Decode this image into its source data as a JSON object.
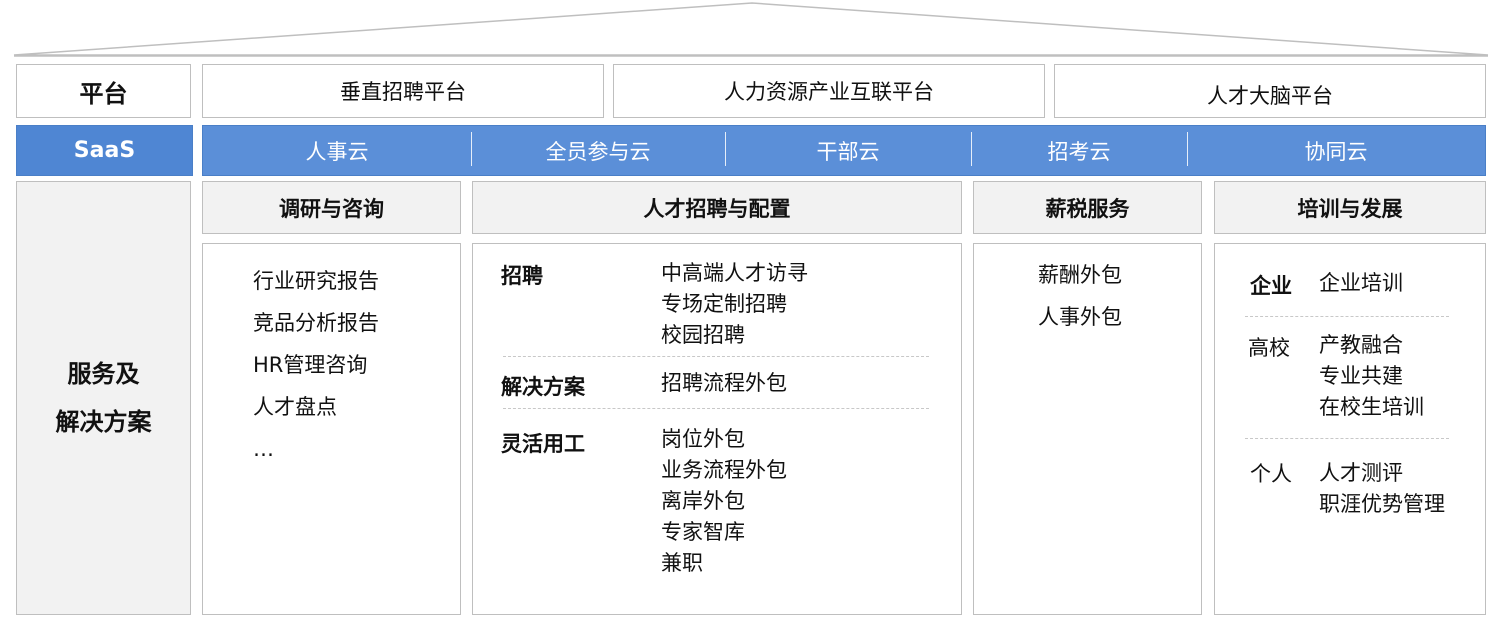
{
  "platform": {
    "label": "平台",
    "items": [
      "垂直招聘平台",
      "人力资源产业互联平台",
      "人才大脑平台"
    ]
  },
  "saas": {
    "label": "SaaS",
    "items": [
      "人事云",
      "全员参与云",
      "干部云",
      "招考云",
      "协同云"
    ]
  },
  "services": {
    "label_line1": "服务及",
    "label_line2": "解决方案",
    "columns": [
      {
        "title": "调研与咨询",
        "items": [
          "行业研究报告",
          "竞品分析报告",
          "HR管理咨询",
          "人才盘点",
          "…"
        ]
      },
      {
        "title": "人才招聘与配置",
        "groups": [
          {
            "name": "招聘",
            "items": [
              "中高端人才访寻",
              "专场定制招聘",
              "校园招聘"
            ]
          },
          {
            "name": "解决方案",
            "items": [
              "招聘流程外包"
            ]
          },
          {
            "name": "灵活用工",
            "items": [
              "岗位外包",
              "业务流程外包",
              "离岸外包",
              "专家智库",
              "兼职"
            ]
          }
        ]
      },
      {
        "title": "薪税服务",
        "items": [
          "薪酬外包",
          "人事外包"
        ]
      },
      {
        "title": "培训与发展",
        "groups": [
          {
            "name": "企业",
            "items": [
              "企业培训"
            ]
          },
          {
            "name": "高校",
            "items": [
              "产教融合",
              "专业共建",
              "在校生培训"
            ]
          },
          {
            "name": "个人",
            "items": [
              "人才测评",
              "职涯优势管理"
            ]
          }
        ]
      }
    ]
  },
  "colors": {
    "saas_blue": "#5b8fd8",
    "saas_label_blue": "#4f86d3",
    "header_gray": "#f2f2f2",
    "border": "#bfbfbf"
  }
}
